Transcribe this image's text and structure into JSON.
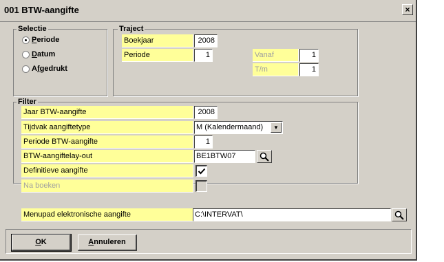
{
  "window": {
    "title": "001 BTW-aangifte",
    "close_label": "×"
  },
  "selectie": {
    "legend": "Selectie",
    "options": [
      {
        "label": "Periode",
        "accel": "P",
        "rest": "eriode",
        "selected": true
      },
      {
        "label": "Datum",
        "accel": "D",
        "rest": "atum",
        "selected": false
      },
      {
        "label": "Afgedrukt",
        "accel": "f",
        "pre": "A",
        "rest": "gedrukt",
        "selected": false
      }
    ]
  },
  "traject": {
    "legend": "Traject",
    "boekjaar_label": "Boekjaar",
    "boekjaar_value": "2008",
    "periode_label": "Periode",
    "periode_value": "1",
    "vanaf_label": "Vanaf",
    "vanaf_value": "1",
    "tm_label": "T/m",
    "tm_value": "1"
  },
  "filter": {
    "legend": "Filter",
    "jaar_label": "Jaar BTW-aangifte",
    "jaar_value": "2008",
    "tijdvak_label": "Tijdvak aangiftetype",
    "tijdvak_value": "M (Kalendermaand)",
    "periode_label": "Periode BTW-aangifte",
    "periode_value": "1",
    "layout_label": "BTW-aangiftelay-out",
    "layout_value": "BE1BTW07",
    "definitief_label": "Definitieve aangifte",
    "definitief_checked": true,
    "naboeken_label": "Na boeken",
    "naboeken_checked": false
  },
  "menupad": {
    "label": "Menupad elektronische aangifte",
    "value": "C:\\INTERVAT\\"
  },
  "buttons": {
    "ok_accel": "O",
    "ok_rest": "K",
    "cancel_accel": "A",
    "cancel_rest": "nnuleren"
  }
}
